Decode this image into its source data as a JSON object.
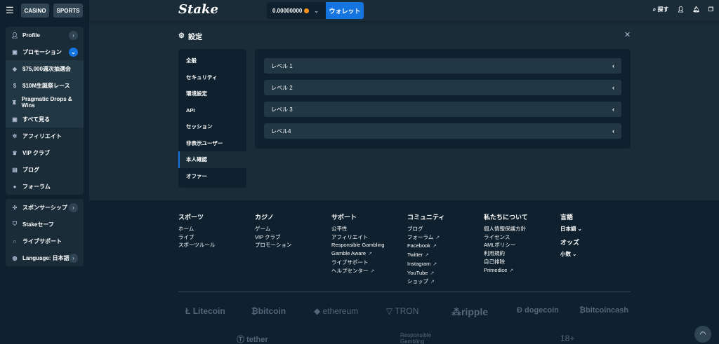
{
  "sidebar": {
    "menu_icon": "hamburger-icon",
    "tabs": {
      "casino": "CASINO",
      "sports": "SPORTS"
    },
    "group1": [
      {
        "label": "Profile",
        "icon": "user-icon",
        "chevron": true
      },
      {
        "label": "プロモーション",
        "icon": "gift-icon",
        "chevron": true,
        "active": true
      }
    ],
    "promo_sub": [
      {
        "label": "$75,000週次抽選会",
        "icon": "ticket-icon"
      },
      {
        "label": "$10M生誕祭レース",
        "icon": "coin-icon"
      },
      {
        "label": "Pragmatic Drops & Wins",
        "icon": "trophy-icon"
      },
      {
        "label": "すべて見る",
        "icon": "gift-icon"
      }
    ],
    "group1b": [
      {
        "label": "アフィリエイト",
        "icon": "affiliate-icon"
      },
      {
        "label": "VIP クラブ",
        "icon": "crown-icon"
      },
      {
        "label": "ブログ",
        "icon": "blog-icon"
      },
      {
        "label": "フォーラム",
        "icon": "forum-icon"
      }
    ],
    "group2": [
      {
        "label": "スポンサーシップ",
        "icon": "handshake-icon",
        "chevron": true
      },
      {
        "label": "Stakeセーフ",
        "icon": "shield-icon"
      },
      {
        "label": "ライブサポート",
        "icon": "headset-icon"
      },
      {
        "label": "Language: 日本語",
        "icon": "globe-icon",
        "chevron": true
      }
    ]
  },
  "topbar": {
    "logo": "Stake",
    "balance": "0.00000000",
    "wallet_label": "ウォレット",
    "search_label": "探す"
  },
  "settings": {
    "title": "設定",
    "menu": [
      "全般",
      "セキュリティ",
      "環境設定",
      "API",
      "セッション",
      "非表示ユーザー",
      "本人確認",
      "オファー"
    ],
    "active_index": 6,
    "levels": [
      "レベル 1",
      "レベル 2",
      "レベル 3",
      "レベル4"
    ]
  },
  "footer": {
    "columns": [
      {
        "heading": "スポーツ",
        "links": [
          {
            "t": "ホーム"
          },
          {
            "t": "ライブ"
          },
          {
            "t": "スポーツルール"
          }
        ]
      },
      {
        "heading": "カジノ",
        "links": [
          {
            "t": "ゲーム"
          },
          {
            "t": "VIP クラブ"
          },
          {
            "t": "プロモーション"
          }
        ]
      },
      {
        "heading": "サポート",
        "links": [
          {
            "t": "公平性"
          },
          {
            "t": "アフィリエイト"
          },
          {
            "t": "Responsible Gambling"
          },
          {
            "t": "Gamble Aware",
            "ext": true
          },
          {
            "t": "ライブサポート"
          },
          {
            "t": "ヘルプセンター",
            "ext": true
          }
        ]
      },
      {
        "heading": "コミュニティ",
        "links": [
          {
            "t": "ブログ"
          },
          {
            "t": "フォーラム",
            "ext": true
          },
          {
            "t": "Facebook",
            "ext": true
          },
          {
            "t": "Twitter",
            "ext": true
          },
          {
            "t": "Instagram",
            "ext": true
          },
          {
            "t": "YouTube",
            "ext": true
          },
          {
            "t": "ショップ",
            "ext": true
          }
        ]
      },
      {
        "heading": "私たちについて",
        "links": [
          {
            "t": "個人情報保護方針"
          },
          {
            "t": "ライセンス"
          },
          {
            "t": "AMLポリシー"
          },
          {
            "t": "利用規約"
          },
          {
            "t": "自己排除"
          },
          {
            "t": "Primedice",
            "ext": true
          }
        ]
      }
    ],
    "language_heading": "言語",
    "language_value": "日本語",
    "odds_heading": "オッズ",
    "odds_value": "小数",
    "brands_row1": [
      "Litecoin",
      "bitcoin",
      "ethereum",
      "TRON",
      "ripple",
      "dogecoin",
      "bitcoincash"
    ],
    "brands_row2": {
      "tether": "tether",
      "rg_line1": "Responsible",
      "rg_line2": "Gambling",
      "age": "18+"
    }
  }
}
